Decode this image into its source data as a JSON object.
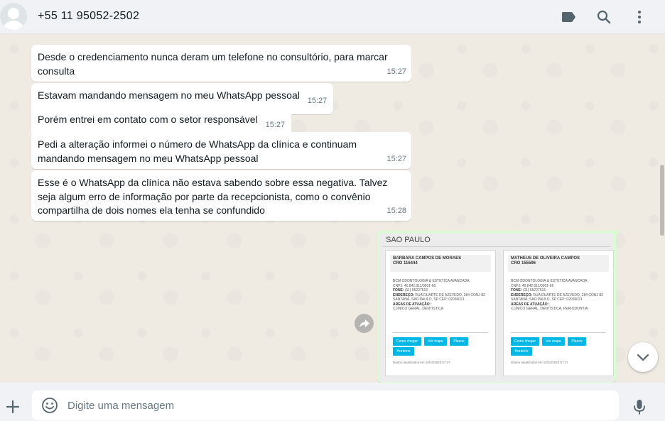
{
  "header": {
    "contact_name": "+55 11 95052-2502"
  },
  "messages": [
    {
      "text": "Desde o credenciamento nunca deram um telefone no consultório, para marcar consulta",
      "time": "15:27"
    },
    {
      "text": "Estavam mandando mensagem no meu WhatsApp pessoal",
      "time": "15:27"
    },
    {
      "text": "Porém entrei em contato com o setor responsável",
      "time": "15:27"
    },
    {
      "text": "Pedi a alteração informei o número de WhatsApp da clínica e continuam mandando mensagem no meu WhatsApp pessoal",
      "time": "15:27"
    },
    {
      "text": "Esse é o WhatsApp da clínica não estava sabendo sobre essa negativa. Talvez seja algum erro de informação por parte da recepcionista, como o convênio compartilha de dois nomes ela tenha se confundido",
      "time": "15:28"
    }
  ],
  "image_message": {
    "city": "SAO PAULO",
    "cards": [
      {
        "name": "BARBARA CAMPOS DE MORAES",
        "cro": "CRO 116444",
        "clinic": "BCM ODONTOLOGIA & ESTETICA AVANCADA",
        "cnpj": "CNPJ: 40.842.011/0001-66",
        "phone_label": "FONE:",
        "phone": "(11) 55227516",
        "address_label": "ENDEREÇO:",
        "address": "RUA DUARTE DE AZEVEDO, 284 CONJ 82 SANTANA, SAO PAULO, SP CEP: 02036021",
        "areas_label": "ÁREAS DE ATUAÇÃO :",
        "areas": "CLINICO GERAL, DENTISTICA",
        "buttons": [
          "Como chegar",
          "Ver mapa",
          "Planos",
          "Horários"
        ],
        "updated": "Dados atualizados em 10/10/2023 07:47"
      },
      {
        "name": "MATHEUS DE OLIVEIRA CAMPOS",
        "cro": "CRO 155596",
        "clinic": "BCM ODONTOLOGIA & ESTETICA AVANCADA",
        "cnpj": "CNPJ: 40.842.011/0001-66",
        "phone_label": "FONE:",
        "phone": "(11) 55227516",
        "address_label": "ENDEREÇO:",
        "address": "RUA DUARTE DE AZEVEDO, 284 CONJ 82 SANTANA, SAO PAULO, SP CEP: 02036021",
        "areas_label": "ÁREAS DE ATUAÇÃO :",
        "areas": "CLINICO GERAL, DENTISTICA, PERIODONTIA",
        "buttons": [
          "Como chegar",
          "Ver mapa",
          "Planos",
          "Horários"
        ],
        "updated": "Dados atualizados em 10/10/2023 07:47"
      }
    ]
  },
  "composer": {
    "placeholder": "Digite uma mensagem"
  },
  "icons": {
    "header": [
      "label-icon",
      "search-icon",
      "menu-icon"
    ],
    "footer": [
      "plus-icon",
      "emoji-icon",
      "mic-icon"
    ]
  },
  "colors": {
    "chat_bg": "#efeae2",
    "incoming_bubble": "#ffffff",
    "outgoing_bubble": "#d9fdd3",
    "header_bg": "#f0f2f5",
    "icon": "#54656f",
    "timestamp": "#667781"
  }
}
